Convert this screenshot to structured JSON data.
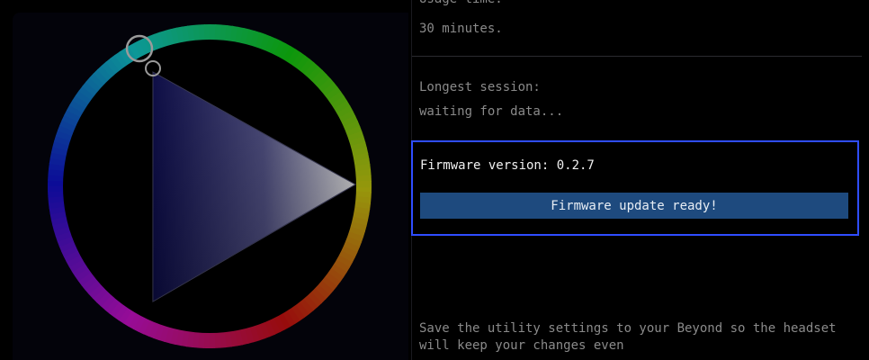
{
  "stats": {
    "usage_time_label": "Usage time:",
    "usage_time_value": "30 minutes.",
    "longest_session_label": "Longest session:",
    "longest_session_value": "waiting for data..."
  },
  "firmware": {
    "version_label": "Firmware version: 0.2.7",
    "update_button_label": "Firmware update ready!"
  },
  "footer": {
    "save_text": "Save the utility settings to your Beyond so the headset will keep your changes even"
  },
  "colors": {
    "background": "#000000",
    "text_gray": "#8a8a8a",
    "firmware_border": "#2f4dff",
    "update_button_bg": "#1e4a7e"
  }
}
